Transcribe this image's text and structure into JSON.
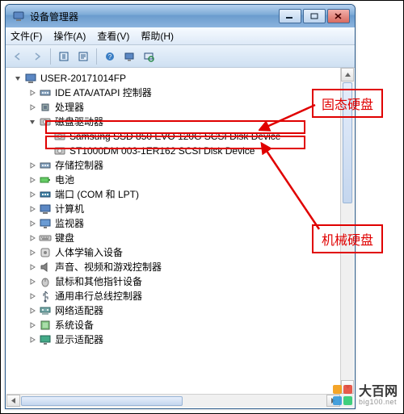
{
  "window": {
    "title": "设备管理器",
    "menus": [
      "文件(F)",
      "操作(A)",
      "查看(V)",
      "帮助(H)"
    ],
    "toolbar_icons": [
      "back-icon",
      "forward-icon",
      "sep",
      "updown-icon",
      "props-icon",
      "sep",
      "help-icon",
      "monitor-icon",
      "refresh-icon"
    ]
  },
  "tree": {
    "root": "USER-20171014FP",
    "items": [
      {
        "label": "IDE ATA/ATAPI 控制器",
        "icon": "controller",
        "expand": "closed"
      },
      {
        "label": "处理器",
        "icon": "cpu",
        "expand": "closed"
      },
      {
        "label": "磁盘驱动器",
        "icon": "disk",
        "expand": "open",
        "children": [
          {
            "label": "Samsung SSD 850 EVO 120G SCSI Disk Device",
            "icon": "disk"
          },
          {
            "label": "ST1000DM 003-1ER162 SCSI Disk Device",
            "icon": "disk"
          }
        ]
      },
      {
        "label": "存储控制器",
        "icon": "controller",
        "expand": "closed"
      },
      {
        "label": "电池",
        "icon": "battery",
        "expand": "closed"
      },
      {
        "label": "端口 (COM 和 LPT)",
        "icon": "port",
        "expand": "closed"
      },
      {
        "label": "计算机",
        "icon": "computer",
        "expand": "closed"
      },
      {
        "label": "监视器",
        "icon": "monitor",
        "expand": "closed"
      },
      {
        "label": "键盘",
        "icon": "keyboard",
        "expand": "closed"
      },
      {
        "label": "人体学输入设备",
        "icon": "hid",
        "expand": "closed"
      },
      {
        "label": "声音、视频和游戏控制器",
        "icon": "sound",
        "expand": "closed"
      },
      {
        "label": "鼠标和其他指针设备",
        "icon": "mouse",
        "expand": "closed"
      },
      {
        "label": "通用串行总线控制器",
        "icon": "usb",
        "expand": "closed"
      },
      {
        "label": "网络适配器",
        "icon": "network",
        "expand": "closed"
      },
      {
        "label": "系统设备",
        "icon": "system",
        "expand": "closed"
      },
      {
        "label": "显示适配器",
        "icon": "display",
        "expand": "closed"
      }
    ]
  },
  "annotations": {
    "hl_ssd": "固态硬盘",
    "hl_hdd": "机械硬盘"
  },
  "watermark": {
    "cn": "大百网",
    "en": "big100.net",
    "colors": [
      "#f39c12",
      "#e74c3c",
      "#3498db",
      "#2ecc71"
    ]
  }
}
